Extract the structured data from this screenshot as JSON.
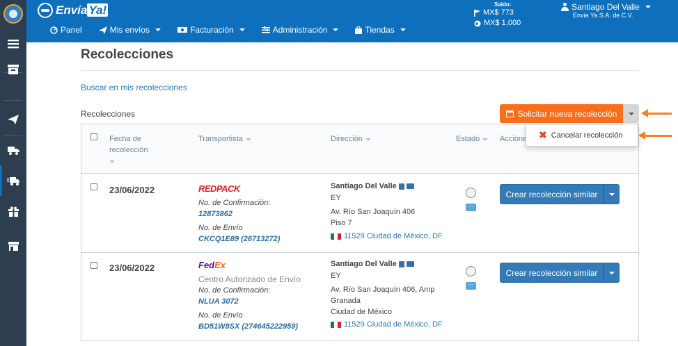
{
  "app": {
    "brand": "Envía",
    "brand_ya": "Ya!"
  },
  "sidebar": {
    "items": [
      "menu-icon",
      "archive-icon",
      "send-icon",
      "truck-icon",
      "delivery-truck-icon",
      "gift-icon",
      "store-icon"
    ]
  },
  "nav": {
    "items": [
      {
        "label": "Panel",
        "icon": "dashboard-icon",
        "has_caret": false
      },
      {
        "label": "Mis envíos",
        "icon": "plane-icon",
        "has_caret": true
      },
      {
        "label": "Facturación",
        "icon": "money-icon",
        "has_caret": true
      },
      {
        "label": "Administración",
        "icon": "sliders-icon",
        "has_caret": true
      },
      {
        "label": "Tiendas",
        "icon": "shopping-bag-icon",
        "has_caret": true
      }
    ]
  },
  "saldo": {
    "label": "Saldo:",
    "balance1": "MX$ 773",
    "balance2": "MX$ 1,000"
  },
  "user": {
    "name": "Santiago Del Valle",
    "company": "Envia Ya S.A. de C.V."
  },
  "page": {
    "title": "Recolecciones",
    "search_link": "Buscar en mis recolecciones",
    "list_label": "Recolecciones",
    "new_button": "Solicitar nueva recolección",
    "dropdown_item": "Cancelar recolección"
  },
  "table": {
    "headers": {
      "date_line1": "Fecha de",
      "date_line2": "recolección",
      "carrier": "Transportista",
      "address": "Dirección",
      "status": "Estado",
      "actions": "Acciones"
    },
    "rows": [
      {
        "date": "23/06/2022",
        "carrier": "REDPACK",
        "carrier_service": "",
        "confirm_label": "No. de Confirmación:",
        "confirm_number": "12873862",
        "shipment_label": "No. de Envío",
        "shipment_number": "CKCQ1E89 (26713272)",
        "contact_name": "Santiago Del Valle",
        "company": "EY",
        "street": "Av. Río San Joaquín 406",
        "line2": "Piso 7",
        "line3": "",
        "city": "11529 Ciudad de México, DF",
        "action_button": "Crear recolección similar"
      },
      {
        "date": "23/06/2022",
        "carrier": "FedEx",
        "carrier_service": "Centro Autorizado de Envío",
        "confirm_label": "No. de Confirmación:",
        "confirm_number": "NLUA 3072",
        "shipment_label": "No. de Envío",
        "shipment_number": "BD51W8SX (274645222959)",
        "contact_name": "Santiago Del Valle",
        "company": "EY",
        "street": "Av. Río San Joaquín 406, Amp",
        "line2": "Granada",
        "line3": "Ciudad de México",
        "city": "11529 Ciudad de México, DF",
        "action_button": "Crear recolección similar"
      }
    ]
  },
  "colors": {
    "topbar": "#0e6fbd",
    "sidebar": "#2d3e50",
    "accent_orange": "#f96e1b",
    "button_blue": "#337ab7"
  }
}
